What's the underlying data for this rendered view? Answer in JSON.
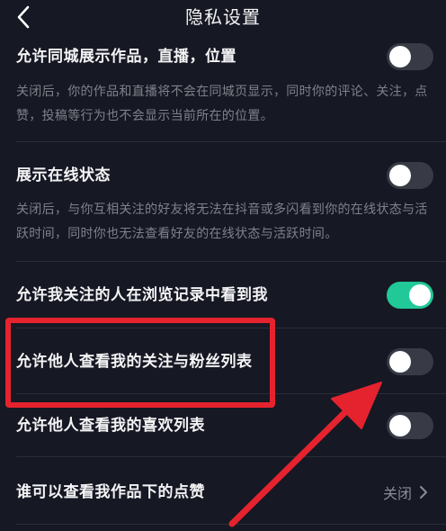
{
  "header": {
    "title": "隐私设置"
  },
  "settings": [
    {
      "label": "允许同城展示作品，直播，位置",
      "description": "关闭后，你的作品和直播将不会在同城页显示，同时你的评论、关注，点赞，投稿等行为也不会显示当前所在的位置。",
      "state": "off"
    },
    {
      "label": "展示在线状态",
      "description": "关闭后，与你互相关注的好友将无法在抖音或多闪看到你的在线状态与活跃时间，同时你也无法查看好友的在线状态与活跃时间。",
      "state": "off"
    },
    {
      "label": "允许我关注的人在浏览记录中看到我",
      "state": "on"
    },
    {
      "label": "允许他人查看我的关注与粉丝列表",
      "state": "off"
    },
    {
      "label": "允许他人查看我的喜欢列表",
      "state": "off"
    },
    {
      "label": "谁可以查看我作品下的点赞",
      "value": "关闭"
    }
  ],
  "icons": {
    "back": "chevron-left-icon",
    "chevron": "chevron-right-icon"
  },
  "colors": {
    "background": "#161823",
    "toggle_on": "#20c997",
    "toggle_off": "#383a45",
    "annotation": "#e5232f"
  }
}
